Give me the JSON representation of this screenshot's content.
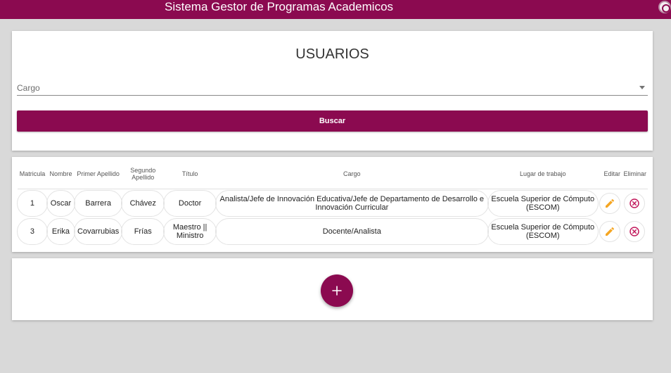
{
  "app": {
    "title": "Sistema Gestor de Programas Academicos",
    "logo_icon": "institution-seal-icon"
  },
  "search": {
    "heading": "USUARIOS",
    "select_label": "Cargo",
    "button_label": "Buscar"
  },
  "table": {
    "headers": [
      "Matricula",
      "Nombre",
      "Primer Apellido",
      "Segundo Apellido",
      "Título",
      "Cargo",
      "Lugar de trabajo",
      "Editar",
      "Eliminar"
    ],
    "rows": [
      {
        "matricula": "1",
        "nombre": "Oscar",
        "primer_apellido": "Barrera",
        "segundo_apellido": "Chávez",
        "titulo": "Doctor",
        "cargo": "Analista/Jefe de Innovación Educativa/Jefe de Departamento de Desarrollo e Innovación Curricular",
        "lugar": "Escuela Superior de Cómputo (ESCOM)"
      },
      {
        "matricula": "3",
        "nombre": "Erika",
        "primer_apellido": "Covarrubias",
        "segundo_apellido": "Frías",
        "titulo": "Maestro || Ministro",
        "cargo": "Docente/Analista",
        "lugar": "Escuela Superior de Cómputo (ESCOM)"
      }
    ]
  },
  "actions": {
    "add_icon": "plus-icon",
    "edit_icon": "pencil-icon",
    "delete_icon": "cancel-circle-icon"
  },
  "colors": {
    "brand": "#8b0a50",
    "edit": "#f5a623",
    "delete": "#c2185b"
  }
}
